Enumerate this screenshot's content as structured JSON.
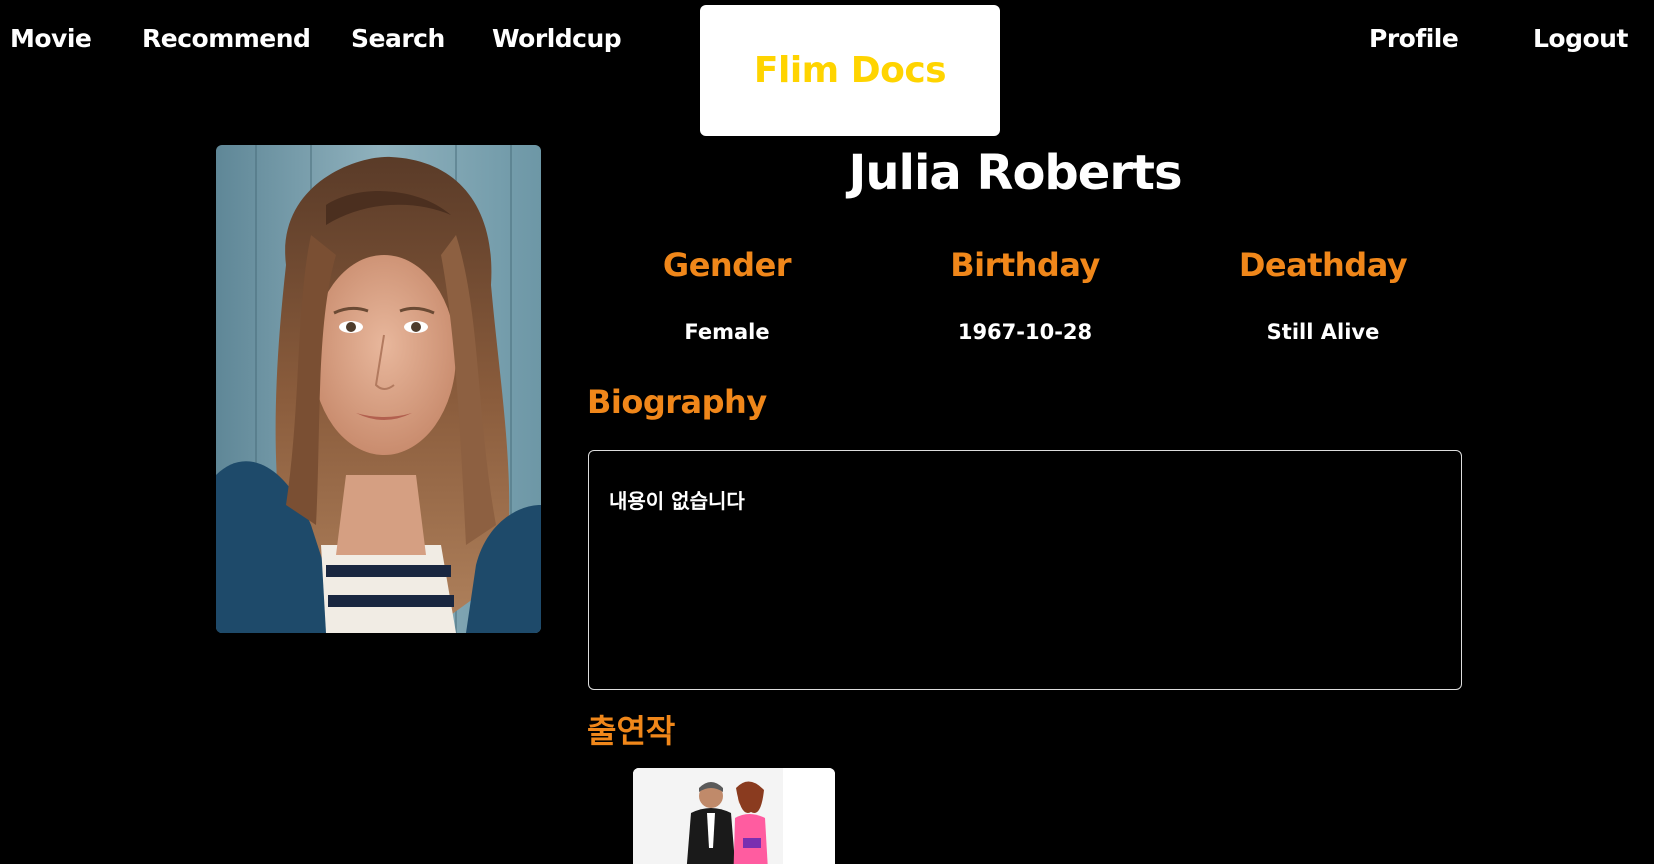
{
  "nav": {
    "movie": "Movie",
    "recommend": "Recommend",
    "search": "Search",
    "worldcup": "Worldcup",
    "profile": "Profile",
    "logout": "Logout"
  },
  "logo": {
    "text": "Flim Docs"
  },
  "person": {
    "name": "Julia Roberts",
    "gender_label": "Gender",
    "gender_value": "Female",
    "birthday_label": "Birthday",
    "birthday_value": "1967-10-28",
    "deathday_label": "Deathday",
    "deathday_value": "Still Alive"
  },
  "biography": {
    "title": "Biography",
    "text": "내용이 없습니다"
  },
  "filmography": {
    "title": "출연작"
  },
  "colors": {
    "background": "#000000",
    "accent_orange": "#f0871a",
    "logo_yellow": "#ffd400"
  }
}
